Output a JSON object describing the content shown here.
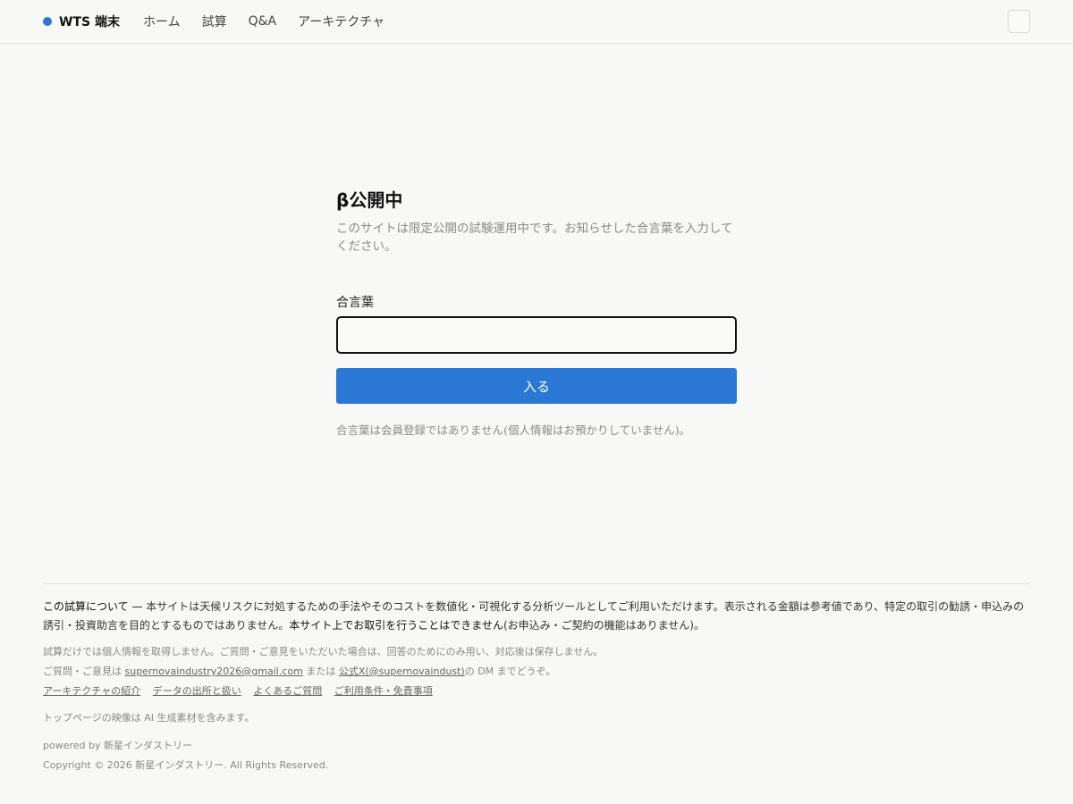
{
  "header": {
    "brand": "WTS 端末",
    "nav": [
      "ホーム",
      "試算",
      "Q&A",
      "アーキテクチャ"
    ]
  },
  "main": {
    "title": "β公開中",
    "description": "このサイトは限定公開の試験運用中です。お知らせした合言葉を入力してください。",
    "field_label": "合言葉",
    "input_value": "",
    "submit_label": "入る",
    "note": "合言葉は会員登録ではありません(個人情報はお預かりしていません)。"
  },
  "footer": {
    "about_lead": "この試算について —",
    "about_text": " 本サイトは天候リスクに対処するための手法やそのコストを数値化・可視化する分析ツールとしてご利用いただけます。表示される金額は参考値であり、特定の取引の勧誘・申込みの誘引・投資助言を目的とするものではありません。",
    "about_emphasis": "本サイト上でお取引を行うことはできません",
    "about_tail": "(お申込み・ご契約の機能はありません)。",
    "privacy": "試算だけでは個人情報を取得しません。ご質問・ご意見をいただいた場合は、回答のためにのみ用い、対応後は保存しません。",
    "contact_prefix": "ご質問・ご意見は ",
    "contact_email": "supernovaindustry2026@gmail.com",
    "contact_mid": " または ",
    "contact_x": "公式X(@supernovaindust)",
    "contact_suffix": "の DM までどうぞ。",
    "links": [
      "アーキテクチャの紹介",
      "データの出所と扱い",
      "よくあるご質問",
      "ご利用条件・免責事項"
    ],
    "ai_note": "トップページの映像は AI 生成素材を含みます。",
    "powered": "powered by 新星インダストリー",
    "copyright": "Copyright © 2026 新星インダストリー. All Rights Reserved."
  }
}
